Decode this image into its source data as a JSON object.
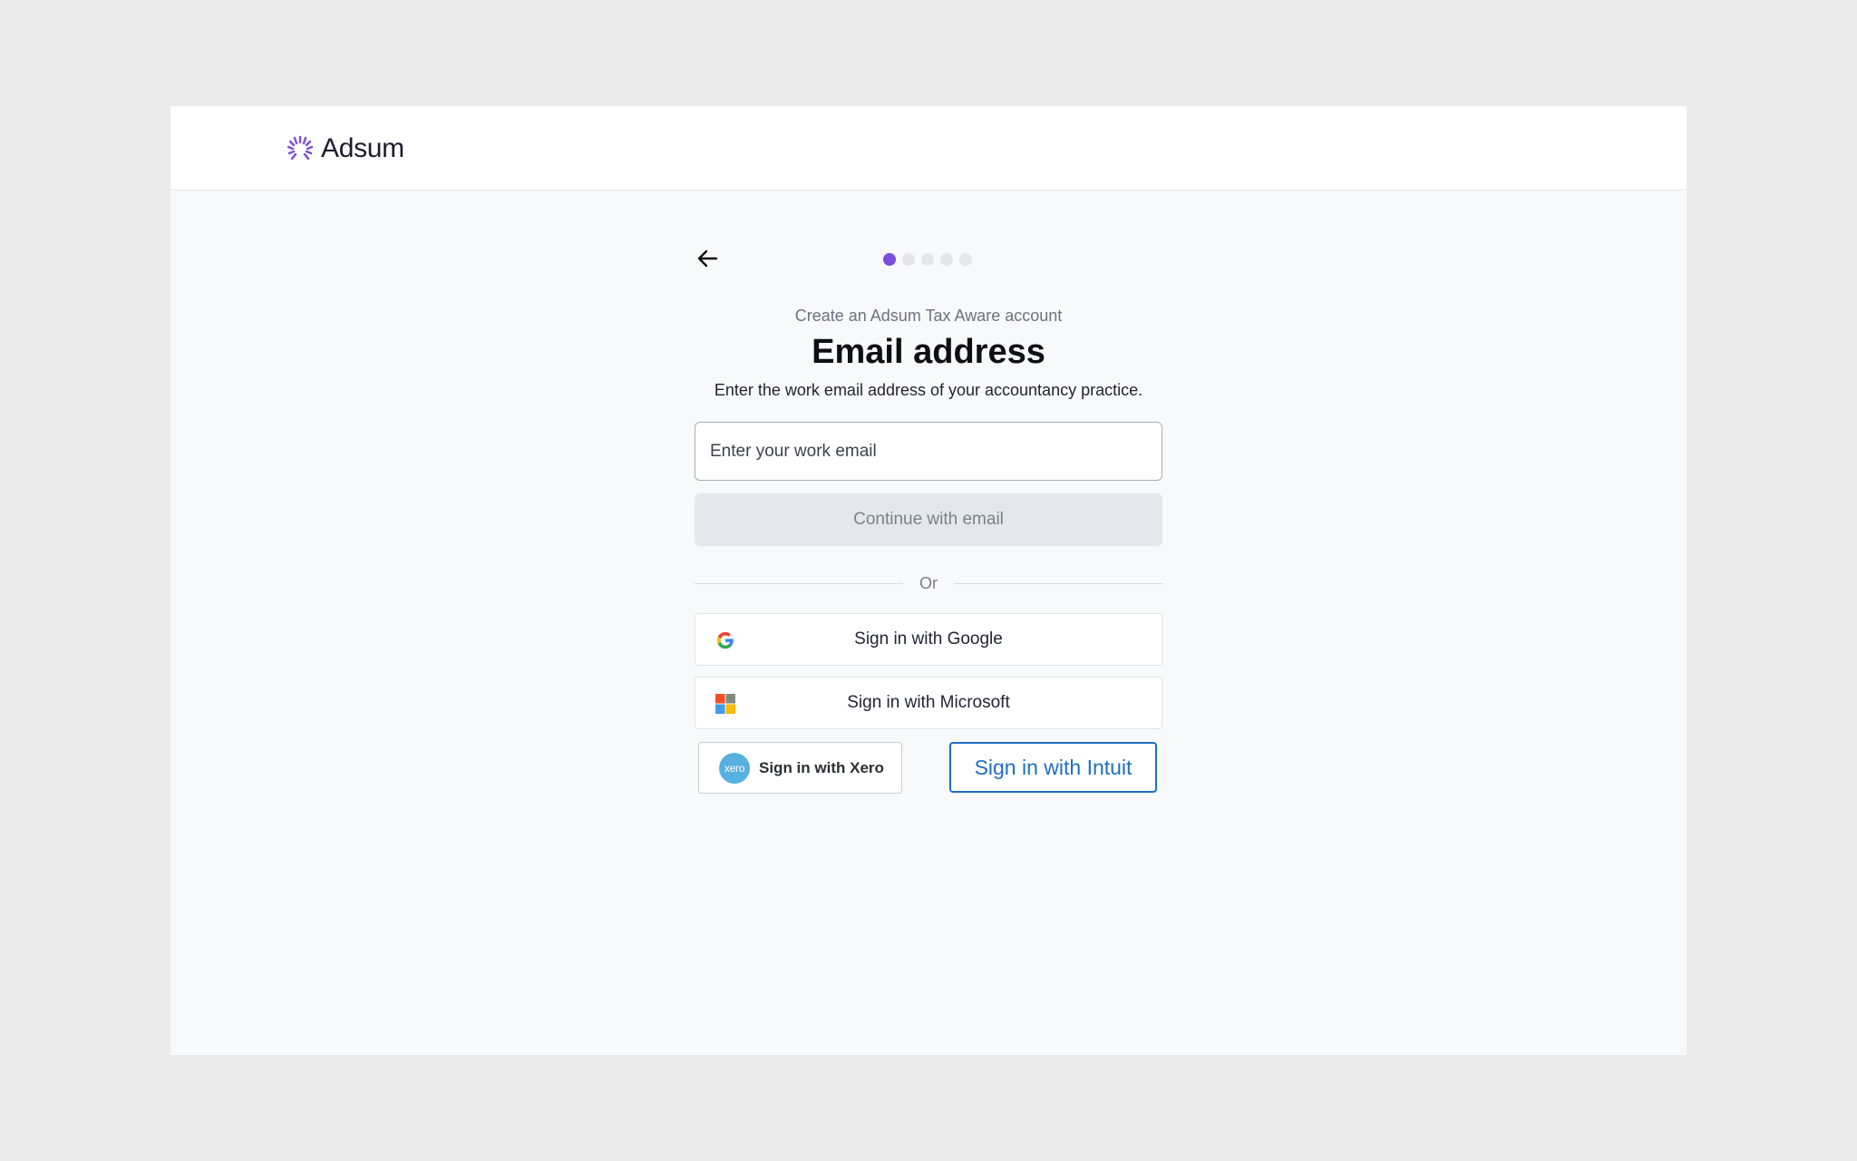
{
  "header": {
    "brand": "Adsum"
  },
  "stepper": {
    "total_steps": 5,
    "current_step": 1
  },
  "form": {
    "pre_title": "Create an Adsum Tax Aware account",
    "title": "Email address",
    "subtitle": "Enter the work email address of your accountancy practice.",
    "email_placeholder": "Enter your work email",
    "email_value": "",
    "continue_label": "Continue with email",
    "divider_label": "Or"
  },
  "social": {
    "google_label": "Sign in with Google",
    "microsoft_label": "Sign in with Microsoft",
    "xero_label": "Sign in with Xero",
    "xero_logo_text": "xero",
    "intuit_label": "Sign in with Intuit"
  },
  "colors": {
    "accent": "#7c4ddf",
    "page_bg": "#f8f9fa",
    "intuit_blue": "#1f6ec2",
    "xero_blue": "#56b0e0"
  }
}
